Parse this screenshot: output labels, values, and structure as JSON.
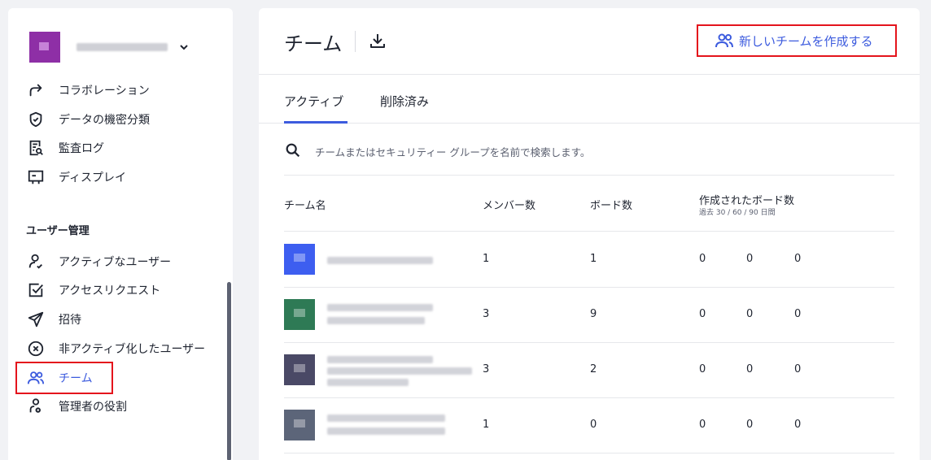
{
  "sidebar": {
    "org_avatar_color": "#8e2fa6",
    "items_top": [
      {
        "label": "コラボレーション",
        "icon": "share-arrow-icon"
      },
      {
        "label": "データの機密分類",
        "icon": "shield-check-icon"
      },
      {
        "label": "監査ログ",
        "icon": "audit-log-icon"
      },
      {
        "label": "ディスプレイ",
        "icon": "display-icon"
      }
    ],
    "section_title": "ユーザー管理",
    "items_users": [
      {
        "label": "アクティブなユーザー",
        "icon": "user-check-icon"
      },
      {
        "label": "アクセスリクエスト",
        "icon": "checkbox-icon"
      },
      {
        "label": "招待",
        "icon": "send-icon"
      },
      {
        "label": "非アクティブ化したユーザー",
        "icon": "circle-x-icon"
      },
      {
        "label": "チーム",
        "icon": "team-icon",
        "active": true
      },
      {
        "label": "管理者の役割",
        "icon": "admin-role-icon"
      }
    ]
  },
  "header": {
    "title": "チーム",
    "new_team_label": "新しいチームを作成する"
  },
  "tabs": [
    {
      "label": "アクティブ",
      "active": true
    },
    {
      "label": "削除済み",
      "active": false
    }
  ],
  "search": {
    "placeholder": "チームまたはセキュリティー グループを名前で検索します。"
  },
  "table": {
    "columns": {
      "name": "チーム名",
      "members": "メンバー数",
      "boards": "ボード数",
      "created": "作成されたボード数",
      "created_sub": "過去 30 / 60 / 90 日間"
    },
    "rows": [
      {
        "color": "#3d5ef0",
        "members": "1",
        "boards": "1",
        "c30": "0",
        "c60": "0",
        "c90": "0"
      },
      {
        "color": "#2e7a55",
        "members": "3",
        "boards": "9",
        "c30": "0",
        "c60": "0",
        "c90": "0"
      },
      {
        "color": "#4a4966",
        "members": "3",
        "boards": "2",
        "c30": "0",
        "c60": "0",
        "c90": "0"
      },
      {
        "color": "#5c6579",
        "members": "1",
        "boards": "0",
        "c30": "0",
        "c60": "0",
        "c90": "0"
      }
    ]
  },
  "colors": {
    "accent": "#3c5bde",
    "highlight": "#e4141c"
  }
}
